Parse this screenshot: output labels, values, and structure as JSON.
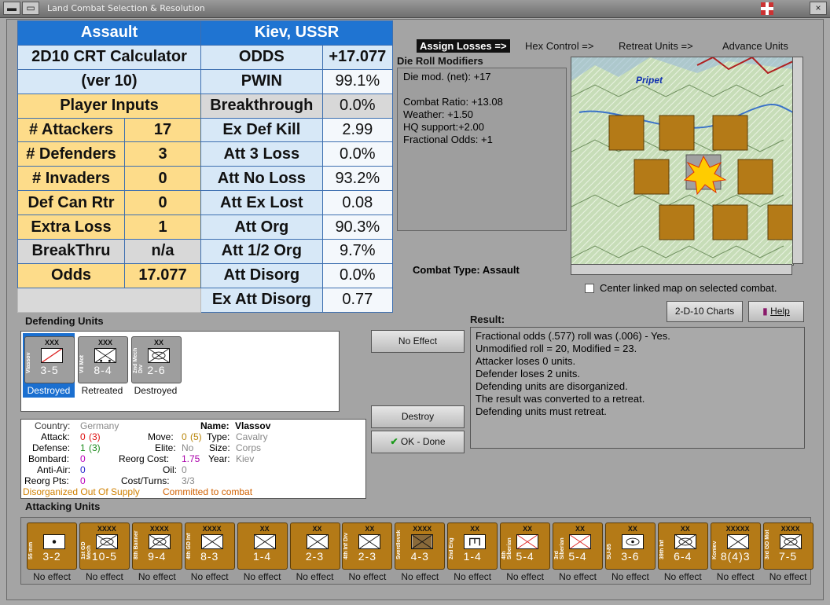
{
  "window": {
    "title": "Land Combat Selection & Resolution"
  },
  "calculator": {
    "header_left": "Assault",
    "header_right": "Kiev, USSR",
    "title_line1": "2D10 CRT Calculator",
    "title_line2": "(ver 10)",
    "section": "Player Inputs",
    "inputs": [
      {
        "label": "# Attackers",
        "value": "17"
      },
      {
        "label": "# Defenders",
        "value": "3"
      },
      {
        "label": "# Invaders",
        "value": "0"
      },
      {
        "label": "Def Can Rtr",
        "value": "0"
      },
      {
        "label": "Extra Loss",
        "value": "1"
      },
      {
        "label": "BreakThru",
        "value": "n/a"
      },
      {
        "label": "Odds",
        "value": "17.077"
      }
    ],
    "odds_label": "ODDS",
    "odds_value": "+17.077",
    "results": [
      {
        "label": "PWIN",
        "value": "99.1%"
      },
      {
        "label": "Breakthrough",
        "value": "0.0%"
      },
      {
        "label": "Ex Def Kill",
        "value": "2.99"
      },
      {
        "label": "Att 3 Loss",
        "value": "0.0%"
      },
      {
        "label": "Att No Loss",
        "value": "93.2%"
      },
      {
        "label": "Att Ex Lost",
        "value": "0.08"
      },
      {
        "label": "Att Org",
        "value": "90.3%"
      },
      {
        "label": "Att 1/2 Org",
        "value": "9.7%"
      },
      {
        "label": "Att Disorg",
        "value": "0.0%"
      },
      {
        "label": "Ex Att Disorg",
        "value": "0.77"
      }
    ]
  },
  "nav": {
    "assign_losses": "Assign Losses =>",
    "hex_control": "Hex Control =>",
    "retreat_units": "Retreat Units =>",
    "advance_units": "Advance Units"
  },
  "die_roll": {
    "title": "Die Roll Modifiers",
    "lines": [
      "Die mod. (net): +17",
      "",
      "Combat Ratio: +13.08",
      "Weather: +1.50",
      "HQ support:+2.00",
      "Fractional Odds: +1"
    ]
  },
  "combat_type": {
    "label": "Combat Type:",
    "value": "Assault"
  },
  "map": {
    "label": "Pripet",
    "center_linked": "Center linked map on selected combat."
  },
  "buttons": {
    "charts": "2-D-10 Charts",
    "help": "Help",
    "no_effect": "No Effect",
    "destroy": "Destroy",
    "ok_done": "OK - Done"
  },
  "defending": {
    "title": "Defending Units",
    "units": [
      {
        "name": "Vlassov",
        "size": "XXX",
        "strength": "3-5",
        "status": "Destroyed",
        "selected": true
      },
      {
        "name": "VII Mot",
        "size": "XXX",
        "strength": "8-4",
        "status": "Retreated",
        "selected": false
      },
      {
        "name": "2nd Mech Div",
        "size": "XX",
        "strength": "2-6",
        "status": "Destroyed",
        "selected": false
      }
    ]
  },
  "unit_info": {
    "country_label": "Country:",
    "country": "Germany",
    "name_label": "Name:",
    "name": "Vlassov",
    "attack_label": "Attack:",
    "attack": "0",
    "attack_paren": "(3)",
    "move_label": "Move:",
    "move": "0",
    "move_paren": "(5)",
    "type_label": "Type:",
    "type": "Cavalry",
    "defense_label": "Defense:",
    "defense": "1",
    "defense_paren": "(3)",
    "elite_label": "Elite:",
    "elite": "No",
    "size_label": "Size:",
    "size": "Corps",
    "bombard_label": "Bombard:",
    "bombard": "0",
    "reorg_label": "Reorg Cost:",
    "reorg": "1.75",
    "year_label": "Year:",
    "year": "Kiev",
    "antiair_label": "Anti-Air:",
    "antiair": "0",
    "oil_label": "Oil:",
    "oil": "0",
    "reorgpts_label": "Reorg Pts:",
    "reorgpts": "0",
    "cost_label": "Cost/Turns:",
    "cost": "3/3",
    "status1": "Disorganized Out Of Supply",
    "status2": "Committed to combat"
  },
  "result": {
    "title": "Result:",
    "lines": [
      "Fractional odds (.577) roll was (.006)  - Yes.",
      "Unmodified roll = 20, Modified = 23.",
      "Attacker loses 0 units.",
      "Defender loses 2 units.",
      "Defending units are disorganized.",
      "The result was converted to a retreat.",
      "Defending units must retreat."
    ]
  },
  "attacking": {
    "title": "Attacking Units",
    "units": [
      {
        "name": "55 mm",
        "size": "",
        "strength": "3-2",
        "status": "No effect"
      },
      {
        "name": "1st GD Mech",
        "size": "XXXX",
        "strength": "10-5",
        "status": "No effect"
      },
      {
        "name": "8th Banner",
        "size": "XXXX",
        "strength": "9-4",
        "status": "No effect"
      },
      {
        "name": "4th GD Inf",
        "size": "XXXX",
        "strength": "8-3",
        "status": "No effect"
      },
      {
        "name": "",
        "size": "XX",
        "strength": "1-4",
        "status": "No effect"
      },
      {
        "name": "",
        "size": "XX",
        "strength": "2-3",
        "status": "No effect"
      },
      {
        "name": "4th Inf Div",
        "size": "XX",
        "strength": "2-3",
        "status": "No effect"
      },
      {
        "name": "Sverdlovsk",
        "size": "XXXX",
        "strength": "4-3",
        "status": "No effect"
      },
      {
        "name": "2nd Eng",
        "size": "XX",
        "strength": "1-4",
        "status": "No effect"
      },
      {
        "name": "4th Siberian",
        "size": "XX",
        "strength": "5-4",
        "status": "No effect"
      },
      {
        "name": "3rd Siberian",
        "size": "XX",
        "strength": "5-4",
        "status": "No effect"
      },
      {
        "name": "SU-85",
        "size": "XX",
        "strength": "3-6",
        "status": "No effect"
      },
      {
        "name": "39th Inf",
        "size": "XX",
        "strength": "6-4",
        "status": "No effect"
      },
      {
        "name": "Koniev",
        "size": "XXXXX",
        "strength": "8(4)3",
        "status": "No effect"
      },
      {
        "name": "3rd GD Mot",
        "size": "XXXX",
        "strength": "7-5",
        "status": "No effect"
      }
    ]
  },
  "colors": {
    "calc_header": "#1f74d2",
    "calc_label": "#d7e8f7",
    "calc_input": "#fddc8a",
    "counter": "#b47a17",
    "selected": "#1a6fd0"
  }
}
